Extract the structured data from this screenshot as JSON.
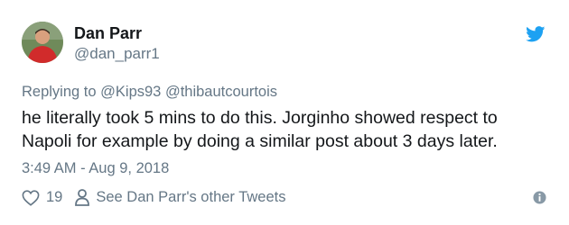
{
  "tweet": {
    "author_name": "Dan Parr",
    "author_handle": "@dan_parr1",
    "replying_prefix": "Replying to",
    "replying_mentions": [
      "@Kips93",
      "@thibautcourtois"
    ],
    "text_line1": "he literally took 5 mins to do this. Jorginho showed respect to",
    "text_line2": "Napoli for example by doing a similar post about 3 days later.",
    "timestamp": "3:49 AM - Aug 9, 2018",
    "like_count": "19",
    "see_other_tweets": "See Dan Parr's other Tweets"
  },
  "icons": {
    "brand": "twitter-bird-icon",
    "like": "heart-icon",
    "profile": "person-icon",
    "info": "info-icon"
  },
  "colors": {
    "twitter_blue": "#1da1f2",
    "muted_text": "#657786",
    "main_text": "#14171a"
  }
}
